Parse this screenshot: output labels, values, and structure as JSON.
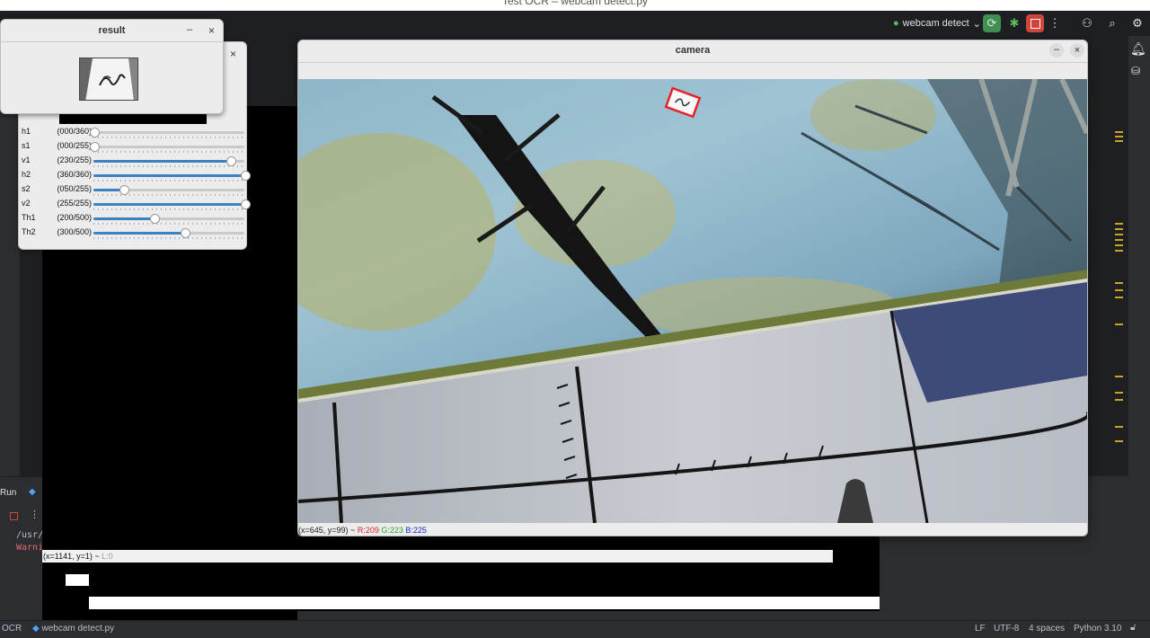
{
  "ide": {
    "title": "Test OCR – webcam detect.py",
    "run_config": "webcam detect",
    "run_tab_label": "Run",
    "console_lines": [
      "/usr/",
      "Warni"
    ],
    "status_bar": {
      "project": "OCR",
      "file": "webcam detect.py",
      "line_separator": "LF",
      "encoding": "UTF-8",
      "indent": "4 spaces",
      "interpreter": "Python 3.10"
    }
  },
  "trackbars": {
    "items": [
      {
        "name": "h1",
        "value": "(000/360)",
        "fraction": 0.0
      },
      {
        "name": "s1",
        "value": "(000/255)",
        "fraction": 0.0
      },
      {
        "name": "v1",
        "value": "(230/255)",
        "fraction": 0.902
      },
      {
        "name": "h2",
        "value": "(360/360)",
        "fraction": 1.0
      },
      {
        "name": "s2",
        "value": "(050/255)",
        "fraction": 0.196
      },
      {
        "name": "v2",
        "value": "(255/255)",
        "fraction": 1.0
      },
      {
        "name": "Th1",
        "value": "(200/500)",
        "fraction": 0.4
      },
      {
        "name": "Th2",
        "value": "(300/500)",
        "fraction": 0.6
      }
    ]
  },
  "result_window": {
    "title": "result",
    "minimize": "–",
    "close": "×"
  },
  "camera_window": {
    "title": "camera",
    "minimize": "–",
    "close": "×",
    "pixel_info": {
      "coords": "(x=645, y=99) ~",
      "r": "R:209",
      "g": "G:223",
      "b": "B:225"
    }
  },
  "lower_status": {
    "coords": "(x=1141, y=1) ~",
    "l": "L:0"
  },
  "icons": {
    "rerun": "rerun-icon",
    "debug": "debug-icon",
    "stop": "stop-icon",
    "more": "more-icon",
    "user": "user-icon",
    "search": "search-icon",
    "settings": "settings-icon",
    "notifications": "bell-icon",
    "database": "database-icon",
    "python": "python-icon",
    "lock": "lock-icon"
  },
  "colors": {
    "accent_green": "#3f8f4e",
    "stop_red": "#d0453a",
    "slider_blue": "#3b82c4",
    "detection_box": "#e8202a"
  }
}
